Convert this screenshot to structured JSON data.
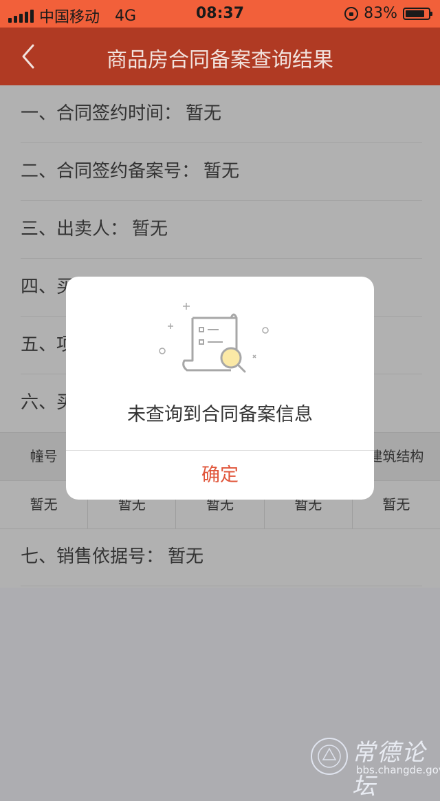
{
  "status_bar": {
    "carrier": "中国移动",
    "network": "4G",
    "time": "08:37",
    "battery_text": "83%",
    "battery_level": 0.83,
    "icons": [
      "signal-icon",
      "rotation-lock-icon",
      "battery-icon"
    ]
  },
  "nav": {
    "title": "商品房合同备案查询结果",
    "back_icon": "chevron-left-icon"
  },
  "rows": [
    {
      "label": "一、合同签约时间：",
      "value": "暂无"
    },
    {
      "label": "二、合同签约备案号：",
      "value": "暂无"
    },
    {
      "label": "三、出卖人：",
      "value": "暂无"
    },
    {
      "label": "四、买",
      "value": ""
    },
    {
      "label": "五、项",
      "value": ""
    },
    {
      "label": "六、买",
      "value": ""
    }
  ],
  "table": {
    "headers": [
      "幢号",
      "",
      "",
      "",
      "建筑结构"
    ],
    "cells": [
      "暂无",
      "暂无",
      "暂无",
      "暂无",
      "暂无"
    ]
  },
  "row7": {
    "label": "七、销售依据号：",
    "value": "暂无"
  },
  "dialog": {
    "icon": "document-search-icon",
    "message": "未查询到合同备案信息",
    "confirm_label": "确定"
  },
  "watermark": {
    "title": "常德论坛",
    "domain": "bbs.changde.gov.cn",
    "badge_text": "常德论坛 bbs.changde.gov.cn"
  },
  "colors": {
    "status_bar": "#f2603a",
    "nav_bar": "#b03a23",
    "accent": "#e0553a",
    "overlay_bg": "#adadb1"
  }
}
